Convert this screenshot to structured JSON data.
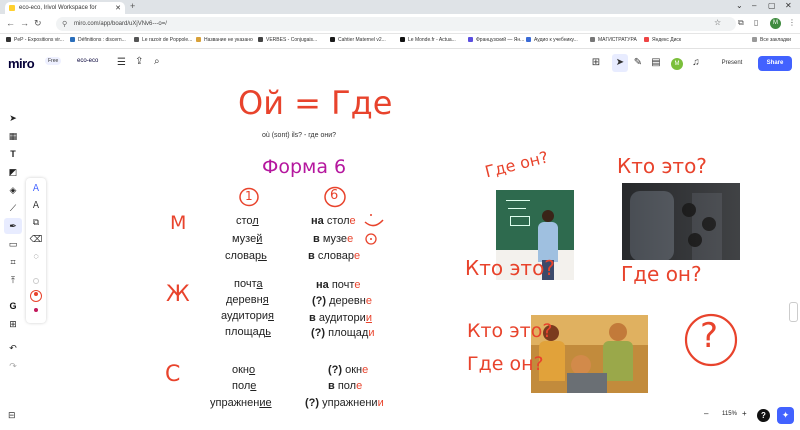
{
  "browser": {
    "tab_title": "eco-eco, Irivol Workspace for",
    "url": "miro.com/app/board/uXjVNv6---o=/",
    "user_initial": "M",
    "bookmarks": [
      "PeP - Expositions vir...",
      "Définitions : discern...",
      "Le razoir de Poppole...",
      "Название не указано",
      "VERBES - Conjugais...",
      "Cahtier Maternel v2...",
      "Le Monde.fr - Actua...",
      "Французский — Ян...",
      "Аудио к учебнику...",
      "МАГИСТРАТУРА",
      "Яндекс Диск"
    ],
    "all_bookmarks": "Все закладки"
  },
  "miro": {
    "logo": "miro",
    "plan_badge": "Free",
    "board_name": "eco-eco",
    "present_label": "Present",
    "share_label": "Share",
    "user_initial": "M",
    "zoom": "115%"
  },
  "canvas": {
    "title": "Ой = Где",
    "subtitle": "où (sont) ils? - где они?",
    "forma": "Форма 6",
    "case1": "1",
    "case6": "6",
    "gender_m": "М",
    "gender_f": "Ж",
    "gender_n": "С",
    "q_top_left": "Где он?",
    "q_top_right": "Кто это?",
    "q_mid_left": "Кто это?",
    "q_mid_right": "Где он?",
    "q_bottom_1": "Кто это?",
    "q_bottom_2": "Где он?",
    "big_question": "?",
    "nouns": {
      "stol_stem": "сто",
      "stol_end": "л",
      "muzey_stem": "музе",
      "muzey_end": "й",
      "slovar_stem": "слова",
      "slovar_end": "рь",
      "pochta_stem": "почт",
      "pochta_end": "а",
      "derevnya_stem": "деревн",
      "derevnya_end": "я",
      "auditoriya_stem": "аудитори",
      "auditoriya_end": "я",
      "ploshad_stem": "площад",
      "ploshad_end": "ь",
      "okno_stem": "окн",
      "okno_end": "о",
      "pole_stem": "пол",
      "pole_end": "е",
      "upr_stem": "упражнен",
      "upr_end": "ие"
    },
    "loc": {
      "na": "на",
      "v": "в",
      "q": "(?)",
      "stole_stem": "стол",
      "stole_end": "е",
      "muzee_stem": "музе",
      "muzee_end": "е",
      "slovare_stem": "словар",
      "slovare_end": "е",
      "pochte_stem": "почт",
      "pochte_end": "е",
      "derevne_stem": "деревн",
      "derevne_end": "е",
      "auditorii_stem": "аудитори",
      "auditorii_end": "и",
      "ploshadi_stem": "площад",
      "ploshadi_end": "и",
      "okne_stem": "окн",
      "okne_end": "е",
      "pole_stem": "пол",
      "pole_end": "е",
      "upr_stem": "упражнени",
      "upr_end": "и"
    }
  }
}
